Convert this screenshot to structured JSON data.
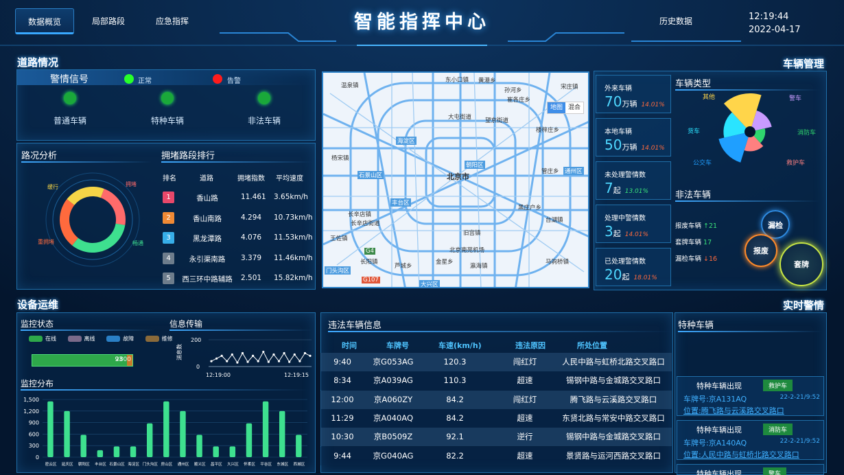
{
  "header": {
    "title": "智能指挥中心",
    "nav": [
      "数据概览",
      "局部路段",
      "应急指挥"
    ],
    "nav_right": "历史数据",
    "time": "12:19:44",
    "date": "2022-04-17"
  },
  "road": {
    "section_title": "道路情况",
    "alert": {
      "title": "警情信号",
      "legend_normal": "正常",
      "legend_alarm": "告警",
      "items": [
        "普通车辆",
        "特种车辆",
        "非法车辆"
      ]
    },
    "condition": {
      "title": "路况分析",
      "labels": [
        "缓行",
        "拥堵",
        "畅通",
        "严重拥堵"
      ]
    },
    "ranking": {
      "title": "拥堵路段排行",
      "headers": [
        "排名",
        "道路",
        "拥堵指数",
        "平均速度"
      ],
      "rows": [
        {
          "rank": "1",
          "road": "香山路",
          "index": "11.461",
          "speed": "3.65km/h"
        },
        {
          "rank": "2",
          "road": "香山南路",
          "index": "4.294",
          "speed": "10.73km/h"
        },
        {
          "rank": "3",
          "road": "黑龙潭路",
          "index": "4.076",
          "speed": "11.53km/h"
        },
        {
          "rank": "4",
          "road": "永引渠南路",
          "index": "3.379",
          "speed": "11.46km/h"
        },
        {
          "rank": "5",
          "road": "西三环中路辅路",
          "index": "2.501",
          "speed": "15.82km/h"
        }
      ]
    }
  },
  "map": {
    "toggle": [
      "地图",
      "混合"
    ],
    "labels": {
      "l1": "温泉镇",
      "l2": "东小口镇",
      "l3": "黄港乡",
      "l4": "孙河乡",
      "l5": "大屯街道",
      "l6": "望京街道",
      "l7": "崔各庄乡",
      "l8": "楼梓庄乡",
      "l9": "海淀区",
      "l10": "朝阳区",
      "l11": "北京市",
      "l12": "石景山区",
      "l13": "丰台区",
      "l14": "长辛店街道",
      "l15": "王佐镇",
      "l16": "黑庄户乡",
      "l17": "台湖镇",
      "l18": "旧宫镇",
      "l19": "北京南苑机场",
      "l20": "长阳镇",
      "l21": "芦城乡",
      "l22": "金星乡",
      "l23": "瀛海镇",
      "l24": "大兴区",
      "l25": "通州区",
      "l26": "马驹桥镇",
      "l27": "门头沟区",
      "l28": "G107",
      "l29": "G4",
      "l30": "宋庄镇",
      "l31": "管庄乡",
      "l32": "长辛店镇",
      "l33": "杨宋镇"
    }
  },
  "vehicle": {
    "section_title": "车辆管理",
    "cards": [
      {
        "label": "外来车辆",
        "value": "70",
        "unit": "万辆",
        "pct": "14.01%",
        "color": "#ff6a3d"
      },
      {
        "label": "本地车辆",
        "value": "50",
        "unit": "万辆",
        "pct": "14.01%",
        "color": "#ff6a3d"
      },
      {
        "label": "未处理警情数",
        "value": "7",
        "unit": "起",
        "pct": "13.01%",
        "color": "#3ae27a"
      },
      {
        "label": "处理中警情数",
        "value": "3",
        "unit": "起",
        "pct": "14.01%",
        "color": "#ff6a3d"
      },
      {
        "label": "已处理警情数",
        "value": "20",
        "unit": "起",
        "pct": "18.01%",
        "color": "#ff6a3d"
      }
    ],
    "types_title": "车辆类型",
    "types": [
      "警车",
      "消防车",
      "救护车",
      "公交车",
      "货车",
      "其他"
    ],
    "illegal_title": "非法车辆",
    "illegal": [
      {
        "label": "报废车辆",
        "value": "↑21",
        "color": "#3ae27a"
      },
      {
        "label": "套牌车辆",
        "value": "17",
        "color": "#3ae27a"
      },
      {
        "label": "漏检车辆",
        "value": "↓16",
        "color": "#ff6a3d"
      }
    ],
    "bubbles": [
      "漏检",
      "报废",
      "套牌"
    ]
  },
  "device": {
    "section_title": "设备运维",
    "monitor_title": "监控状态",
    "legend": [
      "在线",
      "离线",
      "故障",
      "维修"
    ],
    "bar_value": "932800",
    "bar_label_a": "93",
    "bar_label_b": "2800",
    "info_title": "信息传输",
    "info_ylabel": "消息数",
    "info_ymax": "200",
    "info_ymin": "0",
    "info_x": [
      "12:19:00",
      "12:19:15"
    ],
    "dist_title": "监控分布"
  },
  "alerts": {
    "section_title": "实时警情",
    "violations_title": "违法车辆信息",
    "headers": [
      "时间",
      "车牌号",
      "车速(km/h)",
      "违法原因",
      "所处位置"
    ],
    "rows": [
      {
        "time": "9:40",
        "plate": "京G053AG",
        "speed": "120.3",
        "reason": "闯红灯",
        "location": "人民中路与虹桥北路交叉路口"
      },
      {
        "time": "8:34",
        "plate": "京A039AG",
        "speed": "110.3",
        "reason": "超速",
        "location": "锡钢中路与金城路交叉路口"
      },
      {
        "time": "12:00",
        "plate": "京A060ZY",
        "speed": "84.2",
        "reason": "闯红灯",
        "location": "腾飞路与云溪路交叉路口"
      },
      {
        "time": "11:29",
        "plate": "京A040AQ",
        "speed": "84.2",
        "reason": "超速",
        "location": "东贤北路与常安中路交叉路口"
      },
      {
        "time": "10:30",
        "plate": "京B0509Z",
        "speed": "92.1",
        "reason": "逆行",
        "location": "锡钢中路与金城路交叉路口"
      },
      {
        "time": "9:44",
        "plate": "京G040AG",
        "speed": "82.2",
        "reason": "超速",
        "location": "景贤路与运河西路交叉路口"
      }
    ],
    "special_title": "特种车辆",
    "special": [
      {
        "title": "特种车辆出现",
        "badge": "救护车",
        "plate": "车牌号:京A131AQ",
        "time": "22-2-21/9:52",
        "position": "位置:腾飞路与云溪路交叉路口"
      },
      {
        "title": "特种车辆出现",
        "badge": "消防车",
        "plate": "车牌号:京A140AQ",
        "time": "22-2-21/9:52",
        "position": "位置:人民中路与虹桥北路交叉路口"
      },
      {
        "title": "特种车辆出现",
        "badge": "警车",
        "plate": "",
        "time": "",
        "position": ""
      }
    ]
  },
  "chart_data": [
    {
      "type": "pie",
      "title": "路况分析",
      "categories": [
        "缓行",
        "拥堵",
        "畅通",
        "严重拥堵"
      ],
      "values": [
        20,
        22,
        33,
        25
      ],
      "colors": [
        "#f5d547",
        "#ff6b6b",
        "#3ee08f",
        "#ff6a3d"
      ]
    },
    {
      "type": "pie",
      "title": "车辆类型",
      "categories": [
        "警车",
        "消防车",
        "救护车",
        "公交车",
        "货车",
        "其他"
      ],
      "values": [
        22,
        12,
        18,
        36,
        28,
        45
      ],
      "colors": [
        "#c99bff",
        "#2fd66e",
        "#ff8080",
        "#1f9fff",
        "#2ae4ff",
        "#ffd54a"
      ]
    },
    {
      "type": "line",
      "title": "信息传输",
      "ylabel": "消息数",
      "ylim": [
        0,
        200
      ],
      "values": [
        40,
        60,
        80,
        40,
        90,
        30,
        100,
        35,
        80,
        40,
        110,
        35,
        90,
        40,
        100,
        35,
        90,
        40,
        100,
        80
      ]
    },
    {
      "type": "bar",
      "title": "监控分布",
      "categories": [
        "密云区",
        "延庆区",
        "朝阳区",
        "丰台区",
        "石景山区",
        "海淀区",
        "门头沟区",
        "房山区",
        "通州区",
        "顺义区",
        "昌平区",
        "大兴区",
        "怀柔区",
        "平谷区",
        "东城区",
        "西城区"
      ],
      "values": [
        1450,
        1200,
        580,
        180,
        280,
        280,
        880,
        1450,
        1200,
        580,
        280,
        280,
        880,
        1450,
        1200,
        580
      ],
      "ylim": [
        0,
        1500
      ],
      "yticks": [
        "1,500",
        "1,200",
        "900",
        "600",
        "300",
        "0"
      ]
    }
  ]
}
